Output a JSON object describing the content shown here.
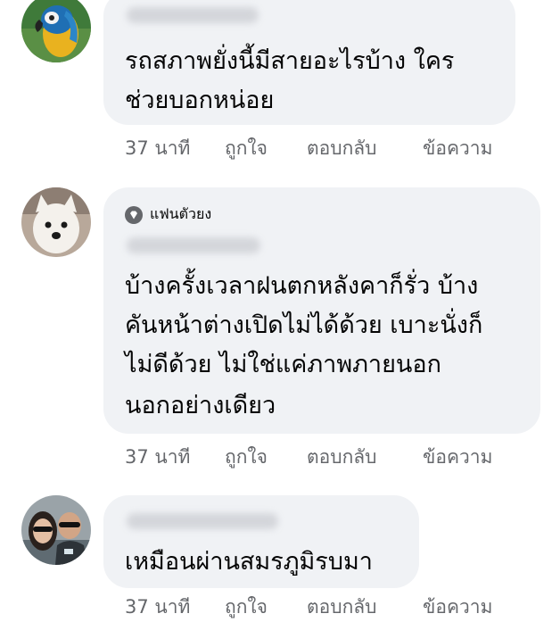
{
  "comments": [
    {
      "text_lines": [
        "รถสภาพยั่งนี้มีสายอะไรบ้าง ใคร",
        "ช่วยบอกหน่อย"
      ],
      "actions": {
        "time": "37 นาที",
        "like": "ถูกใจ",
        "reply": "ตอบกลับ",
        "message": "ข้อความ"
      }
    },
    {
      "badge": "แฟนตัวยง",
      "badge_icon": "diamond-icon",
      "text_lines": [
        "บ้างครั้งเวลาฝนตกหลังคาก็รั่ว บ้าง",
        "คันหน้าต่างเปิดไม่ได้ด้วย เบาะนั่งก็",
        "ไม่ดีด้วย ไม่ใช่แค่ภาพภายนอก",
        "นอกอย่างเดียว"
      ],
      "actions": {
        "time": "37 นาที",
        "like": "ถูกใจ",
        "reply": "ตอบกลับ",
        "message": "ข้อความ"
      }
    },
    {
      "text_lines": [
        "เหมือนผ่านสมรภูมิรบมา"
      ],
      "actions": {
        "time": "37 นาที",
        "like": "ถูกใจ",
        "reply": "ตอบกลับ",
        "message": "ข้อความ"
      }
    }
  ]
}
